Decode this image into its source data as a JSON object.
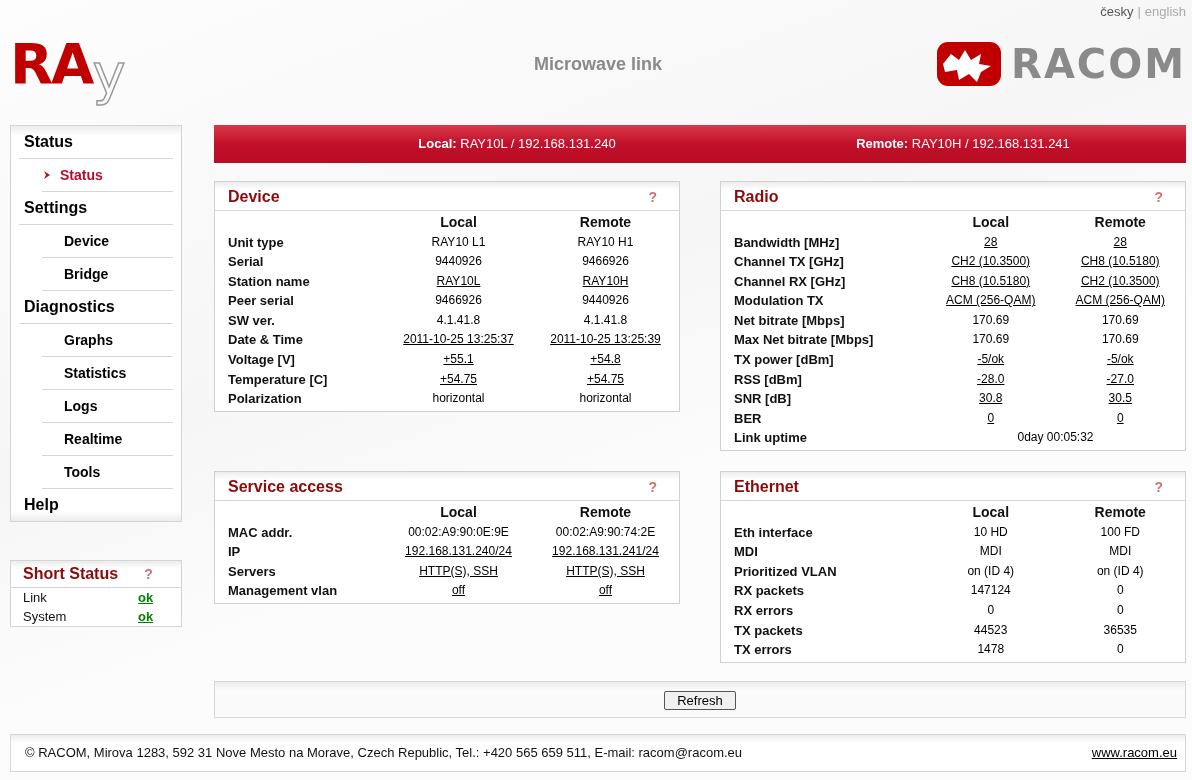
{
  "languages": [
    {
      "label": "česky",
      "selected": false
    },
    {
      "label": "english",
      "selected": true
    }
  ],
  "language_separator": "|",
  "header": {
    "logo": [
      {
        "text": "RA",
        "kind": "solid"
      },
      {
        "text": "y",
        "kind": "outline"
      }
    ],
    "title": "Microwave link",
    "brand": "RACOM"
  },
  "sidebar": {
    "sections": [
      {
        "label": "Status",
        "children": [
          {
            "label": "Status",
            "selected": true
          }
        ]
      },
      {
        "label": "Settings",
        "children": [
          {
            "label": "Device",
            "selected": false
          },
          {
            "label": "Bridge",
            "selected": false
          }
        ]
      },
      {
        "label": "Diagnostics",
        "children": [
          {
            "label": "Graphs",
            "selected": false
          },
          {
            "label": "Statistics",
            "selected": false
          },
          {
            "label": "Logs",
            "selected": false
          },
          {
            "label": "Realtime",
            "selected": false
          },
          {
            "label": "Tools",
            "selected": false
          }
        ]
      },
      {
        "label": "Help"
      }
    ]
  },
  "short_status": {
    "title": "Short Status",
    "help": "?",
    "rows": [
      {
        "label": "Link",
        "value": "ok"
      },
      {
        "label": "System",
        "value": "ok"
      }
    ]
  },
  "link_bar": {
    "local": "**Local:** RAY10L / 192.168.131.240",
    "remote": "**Remote:** RAY10H / 192.168.131.241"
  },
  "panels": [
    {
      "title": "Device",
      "help": "?",
      "columns": [
        "Local",
        "Remote"
      ],
      "rows": [
        {
          "label": "Unit type",
          "kind": "pair",
          "local": {
            "text": "RAY10 L1",
            "link": false
          },
          "remote": {
            "text": "RAY10 H1",
            "link": false
          }
        },
        {
          "label": "Serial",
          "kind": "pair",
          "local": {
            "text": "9440926",
            "link": false
          },
          "remote": {
            "text": "9466926",
            "link": false
          }
        },
        {
          "label": "Station name",
          "kind": "pair",
          "local": {
            "text": "RAY10L",
            "link": true
          },
          "remote": {
            "text": "RAY10H",
            "link": true
          }
        },
        {
          "label": "Peer serial",
          "kind": "pair",
          "local": {
            "text": "9466926",
            "link": false
          },
          "remote": {
            "text": "9440926",
            "link": false
          }
        },
        {
          "label": "SW ver.",
          "kind": "pair",
          "local": {
            "text": "4.1.41.8",
            "link": false
          },
          "remote": {
            "text": "4.1.41.8",
            "link": false
          }
        },
        {
          "label": "Date & Time",
          "kind": "pair",
          "local": {
            "text": "2011-10-25 13:25:37",
            "link": true
          },
          "remote": {
            "text": "2011-10-25 13:25:39",
            "link": true
          }
        },
        {
          "label": "Voltage [V]",
          "kind": "pair",
          "local": {
            "text": "+55.1",
            "link": true
          },
          "remote": {
            "text": "+54.8",
            "link": true
          }
        },
        {
          "label": "Temperature [C]",
          "kind": "pair",
          "local": {
            "text": "+54.75",
            "link": true
          },
          "remote": {
            "text": "+54.75",
            "link": true
          }
        },
        {
          "label": "Polarization",
          "kind": "pair",
          "local": {
            "text": "horizontal",
            "link": false
          },
          "remote": {
            "text": "horizontal",
            "link": false
          }
        }
      ]
    },
    {
      "title": "Radio",
      "help": "?",
      "columns": [
        "Local",
        "Remote"
      ],
      "rows": [
        {
          "label": "Bandwidth [MHz]",
          "kind": "pair",
          "local": {
            "text": "28",
            "link": true
          },
          "remote": {
            "text": "28",
            "link": true
          }
        },
        {
          "label": "Channel TX [GHz]",
          "kind": "pair",
          "local": {
            "text": "CH2 (10.3500)",
            "link": true
          },
          "remote": {
            "text": "CH8 (10.5180)",
            "link": true
          }
        },
        {
          "label": "Channel RX [GHz]",
          "kind": "pair",
          "local": {
            "text": "CH8 (10.5180)",
            "link": true
          },
          "remote": {
            "text": "CH2 (10.3500)",
            "link": true
          }
        },
        {
          "label": "Modulation TX",
          "kind": "pair",
          "local": {
            "text": "ACM (256-QAM)",
            "link": true
          },
          "remote": {
            "text": "ACM (256-QAM)",
            "link": true
          }
        },
        {
          "label": "Net bitrate [Mbps]",
          "kind": "pair",
          "local": {
            "text": "170.69",
            "link": false
          },
          "remote": {
            "text": "170.69",
            "link": false
          }
        },
        {
          "label": "Max Net bitrate [Mbps]",
          "kind": "pair",
          "local": {
            "text": "170.69",
            "link": false
          },
          "remote": {
            "text": "170.69",
            "link": false
          }
        },
        {
          "label": "TX power [dBm]",
          "kind": "pair",
          "local": {
            "text": "-5/ok",
            "link": true
          },
          "remote": {
            "text": "-5/ok",
            "link": true
          }
        },
        {
          "label": "RSS [dBm]",
          "kind": "pair",
          "local": {
            "text": "-28.0",
            "link": true
          },
          "remote": {
            "text": "-27.0",
            "link": true
          }
        },
        {
          "label": "SNR [dB]",
          "kind": "pair",
          "local": {
            "text": "30.8",
            "link": true
          },
          "remote": {
            "text": "30.5",
            "link": true
          }
        },
        {
          "label": "BER",
          "kind": "pair",
          "local": {
            "text": "0",
            "link": true
          },
          "remote": {
            "text": "0",
            "link": true
          }
        },
        {
          "label": "Link uptime",
          "kind": "span",
          "value": {
            "text": "0day 00:05:32",
            "link": false
          }
        }
      ]
    },
    {
      "title": "Service access",
      "help": "?",
      "columns": [
        "Local",
        "Remote"
      ],
      "rows": [
        {
          "label": "MAC addr.",
          "kind": "pair",
          "local": {
            "text": "00:02:A9:90:0E:9E",
            "link": false
          },
          "remote": {
            "text": "00:02:A9:90:74:2E",
            "link": false
          }
        },
        {
          "label": "IP",
          "kind": "pair",
          "local": {
            "text": "192.168.131.240/24",
            "link": true
          },
          "remote": {
            "text": "192.168.131.241/24",
            "link": true
          }
        },
        {
          "label": "Servers",
          "kind": "pair",
          "local": {
            "text": "HTTP(S), SSH",
            "link": true
          },
          "remote": {
            "text": "HTTP(S), SSH",
            "link": true
          }
        },
        {
          "label": "Management vlan",
          "kind": "pair",
          "local": {
            "text": "off",
            "link": true
          },
          "remote": {
            "text": "off",
            "link": true
          }
        }
      ]
    },
    {
      "title": "Ethernet",
      "help": "?",
      "columns": [
        "Local",
        "Remote"
      ],
      "rows": [
        {
          "label": "Eth interface",
          "kind": "pair",
          "local": {
            "text": "10 HD",
            "link": false
          },
          "remote": {
            "text": "100 FD",
            "link": false
          }
        },
        {
          "label": "MDI",
          "kind": "pair",
          "local": {
            "text": "MDI",
            "link": false
          },
          "remote": {
            "text": "MDI",
            "link": false
          }
        },
        {
          "label": "Prioritized VLAN",
          "kind": "pair",
          "local": {
            "text": "on (ID 4)",
            "link": false
          },
          "remote": {
            "text": "on (ID 4)",
            "link": false
          }
        },
        {
          "label": "RX packets",
          "kind": "pair",
          "local": {
            "text": "147124",
            "link": false
          },
          "remote": {
            "text": "0",
            "link": false
          }
        },
        {
          "label": "RX errors",
          "kind": "pair",
          "local": {
            "text": "0",
            "link": false
          },
          "remote": {
            "text": "0",
            "link": false
          }
        },
        {
          "label": "TX packets",
          "kind": "pair",
          "local": {
            "text": "44523",
            "link": false
          },
          "remote": {
            "text": "36535",
            "link": false
          }
        },
        {
          "label": "TX errors",
          "kind": "pair",
          "local": {
            "text": "1478",
            "link": false
          },
          "remote": {
            "text": "0",
            "link": false
          }
        }
      ]
    }
  ],
  "refresh_button": "Refresh",
  "footer": {
    "text": "© RACOM, Mirova 1283, 592 31 Nove Mesto na Morave, Czech Republic, Tel.: +420 565 659 511, E-mail: racom@racom.eu",
    "link": "www.racom.eu"
  }
}
